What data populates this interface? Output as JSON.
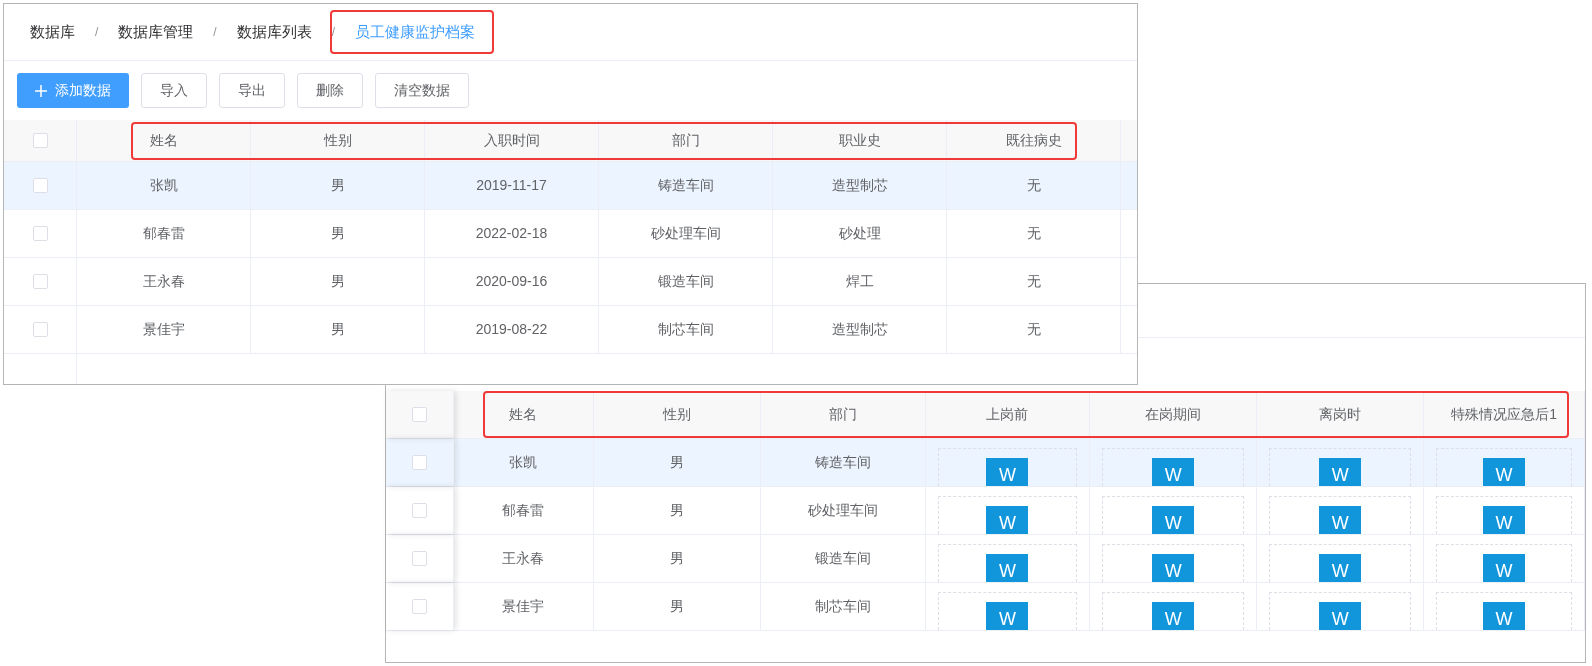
{
  "breadcrumb": {
    "separator": "/",
    "items": [
      {
        "label": "数据库",
        "current": false
      },
      {
        "label": "数据库管理",
        "current": false
      },
      {
        "label": "数据库列表",
        "current": false
      },
      {
        "label": "员工健康监护档案",
        "current": true
      }
    ]
  },
  "toolbar": [
    {
      "label": "添加数据",
      "kind": "primary"
    },
    {
      "label": "导入",
      "kind": "default"
    },
    {
      "label": "导出",
      "kind": "default"
    },
    {
      "label": "删除",
      "kind": "default"
    },
    {
      "label": "清空数据",
      "kind": "default"
    }
  ],
  "records_table": {
    "all_checked": false,
    "columns": [
      "姓名",
      "性别",
      "入职时间",
      "部门",
      "职业史",
      "既往病史"
    ],
    "rows": [
      {
        "selected": true,
        "checked": false,
        "cells": [
          "张凯",
          "男",
          "2019-11-17",
          "铸造车间",
          "造型制芯",
          "无"
        ]
      },
      {
        "selected": false,
        "checked": false,
        "cells": [
          "郁春雷",
          "男",
          "2022-02-18",
          "砂处理车间",
          "砂处理",
          "无"
        ]
      },
      {
        "selected": false,
        "checked": false,
        "cells": [
          "王永春",
          "男",
          "2020-09-16",
          "锻造车间",
          "焊工",
          "无"
        ]
      },
      {
        "selected": false,
        "checked": false,
        "cells": [
          "景佳宇",
          "男",
          "2019-08-22",
          "制芯车间",
          "造型制芯",
          "无"
        ]
      }
    ]
  },
  "files_table": {
    "all_checked": false,
    "columns": [
      "姓名",
      "性别",
      "部门",
      "上岗前",
      "在岗期间",
      "离岗时",
      "特殊情况应急后1"
    ],
    "rows": [
      {
        "selected": true,
        "checked": false,
        "cells": [
          "张凯",
          "男",
          "铸造车间"
        ],
        "files": [
          "W",
          "W",
          "W",
          "W"
        ]
      },
      {
        "selected": false,
        "checked": false,
        "cells": [
          "郁春雷",
          "男",
          "砂处理车间"
        ],
        "files": [
          "W",
          "W",
          "W",
          "W"
        ]
      },
      {
        "selected": false,
        "checked": false,
        "cells": [
          "王永春",
          "男",
          "锻造车间"
        ],
        "files": [
          "W",
          "W",
          "W",
          "W"
        ]
      },
      {
        "selected": false,
        "checked": false,
        "cells": [
          "景佳宇",
          "男",
          "制芯车间"
        ],
        "files": [
          "W",
          "W",
          "W",
          "W"
        ]
      }
    ]
  }
}
